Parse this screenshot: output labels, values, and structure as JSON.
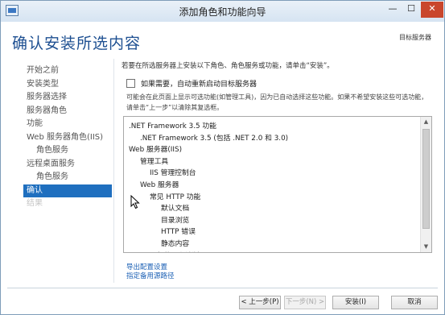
{
  "window": {
    "title": "添加角色和功能向导",
    "controls": {
      "minimize": "—",
      "maximize": "☐",
      "close": "✕"
    }
  },
  "header": {
    "heading": "确认安装所选内容",
    "target_server_label": "目标服务器"
  },
  "nav": {
    "items": [
      {
        "label": "开始之前",
        "state": "normal"
      },
      {
        "label": "安装类型",
        "state": "normal"
      },
      {
        "label": "服务器选择",
        "state": "normal"
      },
      {
        "label": "服务器角色",
        "state": "normal"
      },
      {
        "label": "功能",
        "state": "normal"
      },
      {
        "label": "Web 服务器角色(IIS)",
        "state": "normal"
      },
      {
        "label": "角色服务",
        "state": "sub"
      },
      {
        "label": "远程桌面服务",
        "state": "normal"
      },
      {
        "label": "角色服务",
        "state": "sub"
      },
      {
        "label": "确认",
        "state": "active"
      },
      {
        "label": "结果",
        "state": "disabled"
      }
    ]
  },
  "main": {
    "intro": "若要在所选服务器上安装以下角色、角色服务或功能，请单击“安装”。",
    "restart_checkbox_label": "如果需要，自动重新启动目标服务器",
    "restart_checked": false,
    "note": "可能会在此页面上显示可选功能(如管理工具)，因为已自动选择这些功能。如果不希望安装这些可选功能，请单击“上一步”以清除其复选框。",
    "selection_tree": [
      {
        "label": ".NET Framework 3.5 功能",
        "level": 0
      },
      {
        "label": ".NET Framework 3.5 (包括 .NET 2.0 和 3.0)",
        "level": 1
      },
      {
        "label": "Web 服务器(IIS)",
        "level": 0
      },
      {
        "label": "管理工具",
        "level": 1
      },
      {
        "label": "IIS 管理控制台",
        "level": 2
      },
      {
        "label": "Web 服务器",
        "level": 1
      },
      {
        "label": "常见 HTTP 功能",
        "level": 2
      },
      {
        "label": "默认文档",
        "level": 3
      },
      {
        "label": "目录浏览",
        "level": 3
      },
      {
        "label": "HTTP 错误",
        "level": 3
      },
      {
        "label": "静态内容",
        "level": 3
      },
      {
        "label": "运行状况和诊断",
        "level": 2
      }
    ],
    "links": {
      "export": "导出配置设置",
      "alternate_source": "指定备用源路径"
    }
  },
  "footer": {
    "prev": "< 上一步(P)",
    "next": "下一步(N) >",
    "install": "安装(I)",
    "cancel": "取消"
  },
  "colors": {
    "heading": "#1d4f91",
    "nav_active_bg": "#1f6fbf",
    "link": "#1a5fb4",
    "close_button": "#c9462c"
  }
}
